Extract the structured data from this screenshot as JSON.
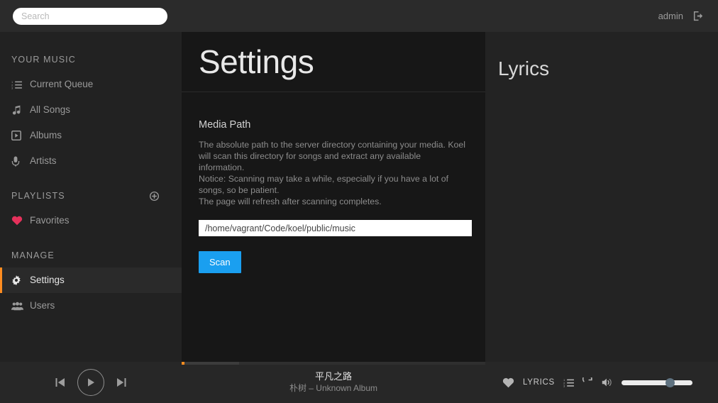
{
  "header": {
    "search_placeholder": "Search",
    "search_value": "",
    "user_name": "admin",
    "logout_icon": "sign-out-icon"
  },
  "sidebar": {
    "sections": [
      {
        "title": "YOUR MUSIC",
        "items": [
          {
            "label": "Current Queue",
            "icon": "list-ol-icon",
            "active": false
          },
          {
            "label": "All Songs",
            "icon": "music-note-icon",
            "active": false
          },
          {
            "label": "Albums",
            "icon": "play-square-icon",
            "active": false
          },
          {
            "label": "Artists",
            "icon": "microphone-icon",
            "active": false
          }
        ]
      },
      {
        "title": "PLAYLISTS",
        "add_icon": "plus-circle-icon",
        "items": [
          {
            "label": "Favorites",
            "icon": "heart-icon",
            "active": false
          }
        ]
      },
      {
        "title": "MANAGE",
        "items": [
          {
            "label": "Settings",
            "icon": "gear-icon",
            "active": true
          },
          {
            "label": "Users",
            "icon": "users-icon",
            "active": false
          }
        ]
      }
    ]
  },
  "main": {
    "title": "Settings",
    "media_path": {
      "label": "Media Path",
      "description": "The absolute path to the server directory containing your media. Koel will scan this directory for songs and extract any available information.\nNotice: Scanning may take a while, especially if you have a lot of songs, so be patient.\nThe page will refresh after scanning completes.",
      "input_value": "/home/vagrant/Code/koel/public/music",
      "input_placeholder": "",
      "scan_button": "Scan"
    }
  },
  "extra_panel": {
    "title": "Lyrics"
  },
  "player": {
    "controls": {
      "previous_icon": "step-backward-icon",
      "play_icon": "play-icon",
      "next_icon": "step-forward-icon"
    },
    "progress": {
      "played_percent": 1,
      "buffered_percent": 19
    },
    "now_playing": {
      "title": "平凡之路",
      "meta": "朴树 – Unknown Album"
    },
    "right_controls": {
      "favorite_icon": "heart-icon",
      "lyrics_label": "LYRICS",
      "queue_icon": "list-ol-icon",
      "repeat_icon": "repeat-icon",
      "volume_icon": "volume-up-icon",
      "volume_percent": 68
    }
  },
  "colors": {
    "accent_orange": "#ff8c20",
    "scan_blue": "#1a9ff0",
    "favorite_pink": "#e5315b",
    "sidebar_bg": "#222222",
    "main_bg": "#171717",
    "panel_bg": "#232323",
    "topbar_bg": "#2b2b2b",
    "player_bg": "#272727",
    "volume_thumb": "#5f7280"
  }
}
